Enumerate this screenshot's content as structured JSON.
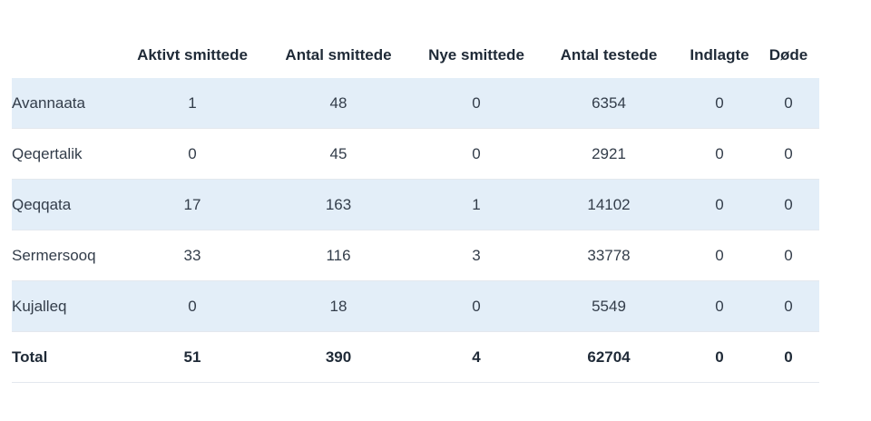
{
  "table": {
    "headers": [
      "",
      "Aktivt smittede",
      "Antal smittede",
      "Nye smittede",
      "Antal testede",
      "Indlagte",
      "Døde"
    ],
    "rows": [
      [
        "Avannaata",
        "1",
        "48",
        "0",
        "6354",
        "0",
        "0"
      ],
      [
        "Qeqertalik",
        "0",
        "45",
        "0",
        "2921",
        "0",
        "0"
      ],
      [
        "Qeqqata",
        "17",
        "163",
        "1",
        "14102",
        "0",
        "0"
      ],
      [
        "Sermersooq",
        "33",
        "116",
        "3",
        "33778",
        "0",
        "0"
      ],
      [
        "Kujalleq",
        "0",
        "18",
        "0",
        "5549",
        "0",
        "0"
      ]
    ],
    "total": [
      "Total",
      "51",
      "390",
      "4",
      "62704",
      "0",
      "0"
    ]
  },
  "colors": {
    "row_shade": "#e3eef8",
    "text": "#333d4a",
    "header_text": "#1f2a37"
  }
}
